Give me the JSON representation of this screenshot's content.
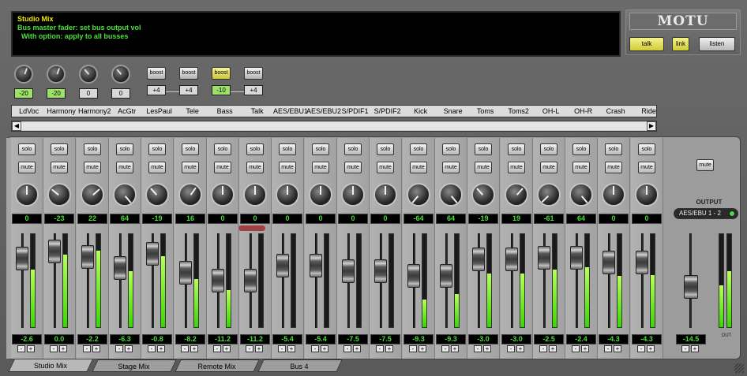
{
  "display": {
    "title": "Studio Mix",
    "line1": "Bus master fader: set bus output vol",
    "line2": "  With option: apply to all busses"
  },
  "brand": "MOTU",
  "talkback": {
    "talk": "talk",
    "link": "link",
    "listen": "listen"
  },
  "inputs": [
    {
      "gain": "-20"
    },
    {
      "gain": "-20"
    },
    {
      "gain": "0"
    },
    {
      "gain": "0"
    }
  ],
  "boosts": [
    {
      "label": "boost",
      "value": "+4",
      "on": false
    },
    {
      "label": "boost",
      "value": "+4",
      "on": false
    },
    {
      "label": "boost",
      "value": "-10",
      "on": true
    },
    {
      "label": "boost",
      "value": "+4",
      "on": false
    }
  ],
  "channels": [
    {
      "name": "LdVoc",
      "pan": "0",
      "fader": "-2.6",
      "meter": 0.62
    },
    {
      "name": "Harmony",
      "pan": "-23",
      "fader": "0.0",
      "meter": 0.78
    },
    {
      "name": "Harmony2",
      "pan": "22",
      "fader": "-2.2",
      "meter": 0.82
    },
    {
      "name": "AcGtr",
      "pan": "64",
      "fader": "-6.3",
      "meter": 0.6
    },
    {
      "name": "LesPaul",
      "pan": "-19",
      "fader": "-0.8",
      "meter": 0.76
    },
    {
      "name": "Tele",
      "pan": "16",
      "fader": "-8.2",
      "meter": 0.52
    },
    {
      "name": "Bass",
      "pan": "0",
      "fader": "-11.2",
      "meter": 0.4
    },
    {
      "name": "Talk",
      "pan": "0",
      "fader": "-11.2",
      "meter": 0
    },
    {
      "name": "AES/EBU1",
      "pan": "0",
      "fader": "-5.4",
      "meter": 0
    },
    {
      "name": "AES/EBU2",
      "pan": "0",
      "fader": "-5.4",
      "meter": 0
    },
    {
      "name": "S/PDIF1",
      "pan": "0",
      "fader": "-7.5",
      "meter": 0
    },
    {
      "name": "S/PDIF2",
      "pan": "0",
      "fader": "-7.5",
      "meter": 0
    },
    {
      "name": "Kick",
      "pan": "-64",
      "fader": "-9.3",
      "meter": 0.3
    },
    {
      "name": "Snare",
      "pan": "64",
      "fader": "-9.3",
      "meter": 0.36
    },
    {
      "name": "Toms",
      "pan": "-19",
      "fader": "-3.0",
      "meter": 0.58
    },
    {
      "name": "Toms2",
      "pan": "19",
      "fader": "-3.0",
      "meter": 0.58
    },
    {
      "name": "OH-L",
      "pan": "-61",
      "fader": "-2.5",
      "meter": 0.62
    },
    {
      "name": "OH-R",
      "pan": "64",
      "fader": "-2.4",
      "meter": 0.64
    },
    {
      "name": "Crash",
      "pan": "0",
      "fader": "-4.3",
      "meter": 0.55
    },
    {
      "name": "Ride",
      "pan": "0",
      "fader": "-4.3",
      "meter": 0.56
    }
  ],
  "strip_labels": {
    "solo": "solo",
    "mute": "mute",
    "plus": "+",
    "minus": "-"
  },
  "output": {
    "mute": "mute",
    "label": "OUTPUT",
    "bus": "AES/EBU 1 - 2",
    "fader": "-14.5",
    "meter_label": "OUT",
    "meter_l": 0.45,
    "meter_r": 0.6
  },
  "tabs": [
    "Studio Mix",
    "Stage Mix",
    "Remote Mix",
    "Bus 4"
  ],
  "selected_tab": "Studio Mix",
  "colors": {
    "display_title": "#f2e600",
    "display_text": "#4be03c",
    "meter_green": "#38d800",
    "boost_on": "#cbc63a"
  }
}
